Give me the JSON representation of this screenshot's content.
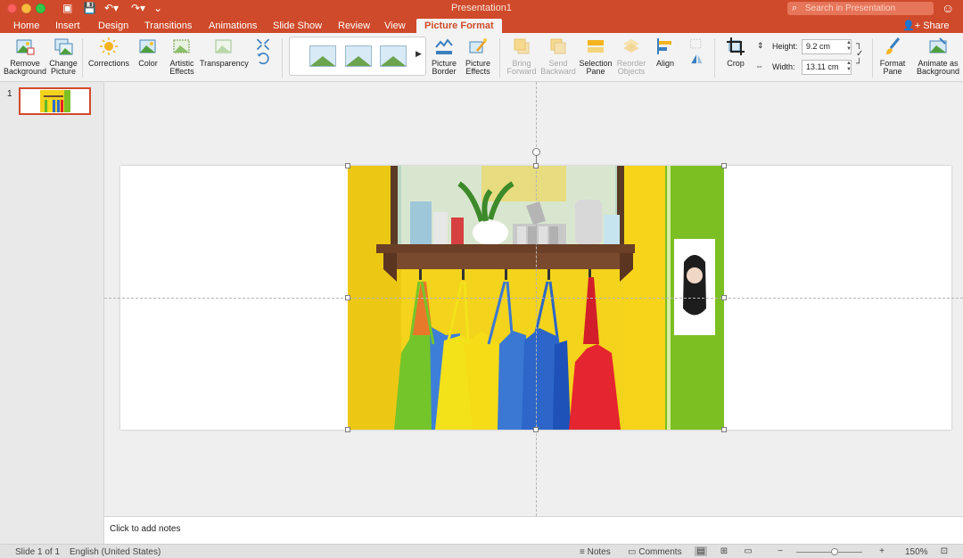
{
  "window": {
    "title": "Presentation1",
    "search_placeholder": "Search in Presentation",
    "share_label": "Share"
  },
  "tabs": [
    "Home",
    "Insert",
    "Design",
    "Transitions",
    "Animations",
    "Slide Show",
    "Review",
    "View",
    "Picture Format"
  ],
  "active_tab": "Picture Format",
  "ribbon": {
    "remove_bg": [
      "Remove",
      "Background"
    ],
    "change_pic": [
      "Change",
      "Picture"
    ],
    "corrections": "Corrections",
    "color": "Color",
    "artistic": [
      "Artistic",
      "Effects"
    ],
    "transparency": "Transparency",
    "picture_border": [
      "Picture",
      "Border"
    ],
    "picture_effects": [
      "Picture",
      "Effects"
    ],
    "bring_forward": [
      "Bring",
      "Forward"
    ],
    "send_backward": [
      "Send",
      "Backward"
    ],
    "selection_pane": [
      "Selection",
      "Pane"
    ],
    "reorder_objects": [
      "Reorder",
      "Objects"
    ],
    "align": "Align",
    "crop": "Crop",
    "height_label": "Height:",
    "height_value": "9.2 cm",
    "width_label": "Width:",
    "width_value": "13.11 cm",
    "format_pane": [
      "Format",
      "Pane"
    ],
    "animate_bg": [
      "Animate as",
      "Background"
    ]
  },
  "thumbnails": [
    {
      "number": "1"
    }
  ],
  "notes": {
    "placeholder": "Click to add notes"
  },
  "status": {
    "slide": "Slide 1 of 1",
    "language": "English (United States)",
    "notes": "Notes",
    "comments": "Comments",
    "zoom": "150%",
    "zoom_level": 0.58
  },
  "icons": {
    "save": "floppy-icon",
    "undo": "undo-icon",
    "redo": "redo-icon",
    "search": "search-icon",
    "share": "add-person-icon"
  },
  "colors": {
    "brand": "#cf4a2a",
    "ribbon_bg": "#f3f3f3",
    "canvas_bg": "#efefef"
  }
}
